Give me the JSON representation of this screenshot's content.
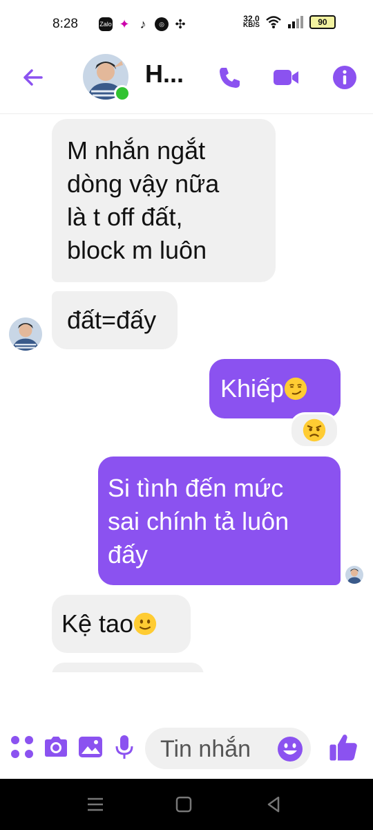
{
  "status": {
    "time": "8:28",
    "speed_value": "32.0",
    "speed_unit": "KB/S",
    "battery": "90",
    "zalo_label": "Zalo"
  },
  "header": {
    "contact_name": "H...",
    "accent_color": "#8b52f0"
  },
  "messages": [
    {
      "from": "contact",
      "lines": [
        "M nhắn ngắt",
        "dòng vậy nữa",
        "là t off đất,",
        "block m luôn"
      ]
    },
    {
      "from": "contact",
      "text": "đất=đấy"
    },
    {
      "from": "me",
      "text": "Khiếp",
      "emoji": "smirk-emoji",
      "reaction": "angry-emoji"
    },
    {
      "from": "me",
      "lines": [
        "Si tình đến mức",
        "sai chính tả luôn",
        "đấy"
      ]
    },
    {
      "from": "contact",
      "text": "Kệ tao",
      "emoji": "slight-smile-emoji"
    }
  ],
  "composer": {
    "placeholder": "Tin nhắn"
  },
  "icons": {
    "apps": "apps-icon",
    "camera": "camera-icon",
    "gallery": "image-icon",
    "mic": "mic-icon",
    "emoji": "emoji-icon",
    "like": "thumbs-up-icon"
  }
}
